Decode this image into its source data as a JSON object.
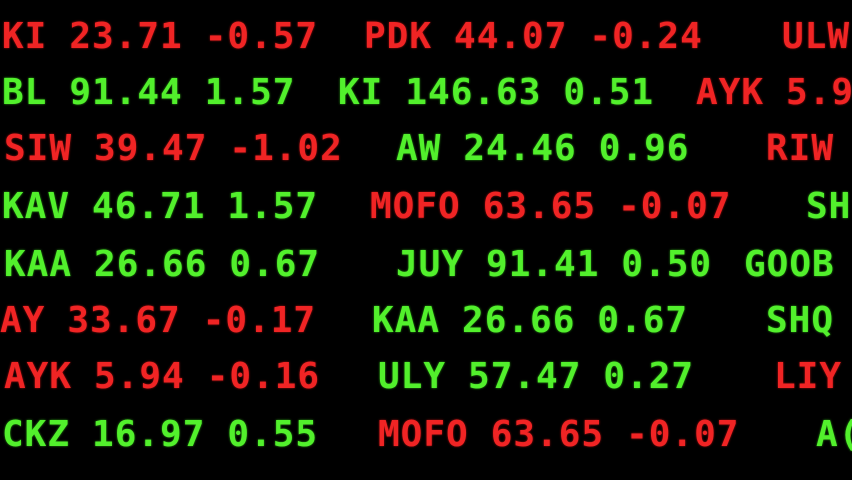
{
  "colors": {
    "up": "#52f02c",
    "down": "#f02424",
    "background": "#000000"
  },
  "ticker_rows": [
    {
      "quotes": [
        {
          "symbol": "KI",
          "price": "23.71",
          "change": "-0.57",
          "dir": "down"
        },
        {
          "symbol": "PDK",
          "price": "44.07",
          "change": "-0.24",
          "dir": "down"
        },
        {
          "symbol": "ULW",
          "price": "",
          "change": "",
          "dir": "down"
        }
      ]
    },
    {
      "quotes": [
        {
          "symbol": "BL",
          "price": "91.44",
          "change": "1.57",
          "dir": "up"
        },
        {
          "symbol": "KI",
          "price": "146.63",
          "change": "0.51",
          "dir": "up"
        },
        {
          "symbol": "AYK",
          "price": "5.9",
          "change": "",
          "dir": "down"
        }
      ]
    },
    {
      "quotes": [
        {
          "symbol": "SIW",
          "price": "39.47",
          "change": "-1.02",
          "dir": "down"
        },
        {
          "symbol": "AW",
          "price": "24.46",
          "change": "0.96",
          "dir": "up"
        },
        {
          "symbol": "RIW",
          "price": "",
          "change": "",
          "dir": "down"
        }
      ]
    },
    {
      "quotes": [
        {
          "symbol": "KAV",
          "price": "46.71",
          "change": "1.57",
          "dir": "up"
        },
        {
          "symbol": "MOFO",
          "price": "63.65",
          "change": "-0.07",
          "dir": "down"
        },
        {
          "symbol": "SH",
          "price": "",
          "change": "",
          "dir": "up"
        }
      ]
    },
    {
      "quotes": [
        {
          "symbol": "KAA",
          "price": "26.66",
          "change": "0.67",
          "dir": "up"
        },
        {
          "symbol": "JUY",
          "price": "91.41",
          "change": "0.50",
          "dir": "up"
        },
        {
          "symbol": "GOOB",
          "price": "",
          "change": "",
          "dir": "up"
        }
      ]
    },
    {
      "quotes": [
        {
          "symbol": "AY",
          "price": "33.67",
          "change": "-0.17",
          "dir": "down"
        },
        {
          "symbol": "KAA",
          "price": "26.66",
          "change": "0.67",
          "dir": "up"
        },
        {
          "symbol": "SHQ",
          "price": "",
          "change": "",
          "dir": "up"
        }
      ]
    },
    {
      "quotes": [
        {
          "symbol": "AYK",
          "price": "5.94",
          "change": "-0.16",
          "dir": "down"
        },
        {
          "symbol": "ULY",
          "price": "57.47",
          "change": "0.27",
          "dir": "up"
        },
        {
          "symbol": "LIY",
          "price": "",
          "change": "",
          "dir": "down"
        }
      ]
    },
    {
      "quotes": [
        {
          "symbol": "CKZ",
          "price": "16.97",
          "change": "0.55",
          "dir": "up"
        },
        {
          "symbol": "MOFO",
          "price": "63.65",
          "change": "-0.07",
          "dir": "down"
        },
        {
          "symbol": "A(",
          "price": "",
          "change": "",
          "dir": "up"
        }
      ]
    }
  ]
}
